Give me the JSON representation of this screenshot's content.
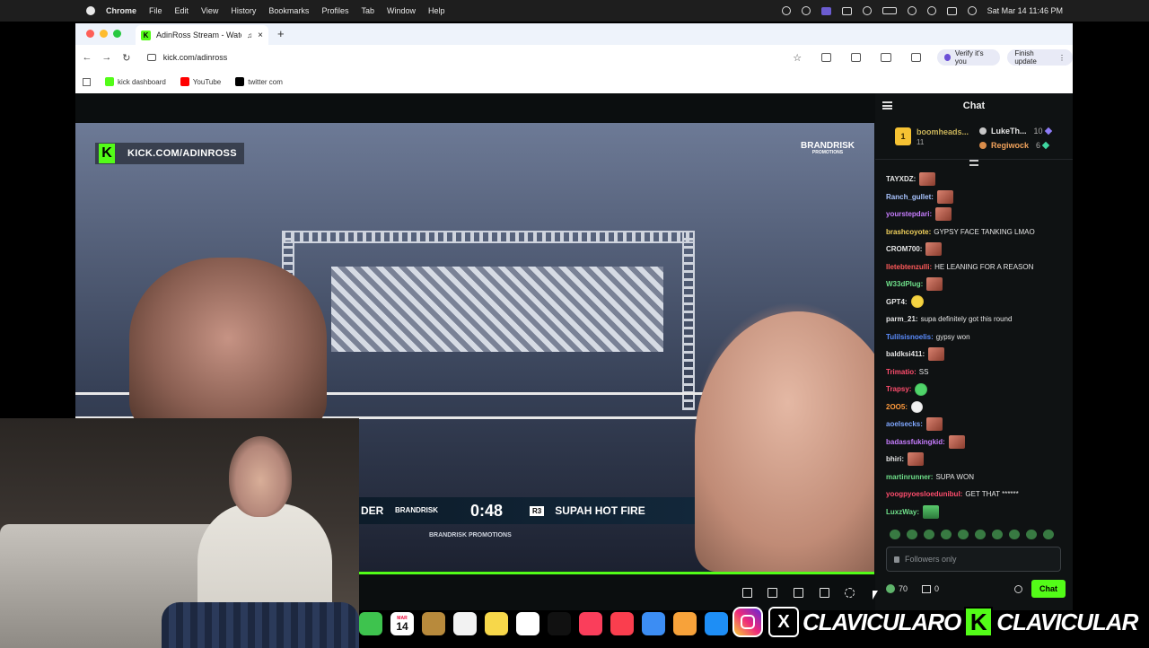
{
  "menubar": {
    "app": "Chrome",
    "items": [
      "File",
      "Edit",
      "View",
      "History",
      "Bookmarks",
      "Profiles",
      "Tab",
      "Window",
      "Help"
    ],
    "clock": "Sat Mar 14  11:46 PM"
  },
  "browser": {
    "tab_title": "AdinRoss Stream - Watch",
    "url": "kick.com/adinross",
    "verify_label": "Verify it's you",
    "finish_label": "Finish update",
    "bookmarks": [
      {
        "label": "kick dashboard",
        "color": "#53fc18"
      },
      {
        "label": "YouTube",
        "color": "#ff0000"
      },
      {
        "label": "twitter com",
        "color": "#000000"
      }
    ]
  },
  "video": {
    "watermark": "KICK.COM/ADINROSS",
    "corner_brand": "BRANDRISK",
    "corner_brand_sub": "PROMOTIONS",
    "score": {
      "left_name": "DER",
      "brand": "BRANDRISK",
      "time": "0:48",
      "round": "R3",
      "right_name": "SUPAH HOT FIRE",
      "promo": "BRANDRISK PROMOTIONS"
    },
    "progress_color": "#53fc18"
  },
  "chat": {
    "title": "Chat",
    "leaderboard": {
      "first": {
        "rank": "1",
        "name": "boomheads...",
        "gifts": "11"
      },
      "second": {
        "name": "LukeTh...",
        "count": "10"
      },
      "third": {
        "name": "Regiwock",
        "count": "6"
      }
    },
    "messages": [
      {
        "user": "TAYXDZ:",
        "color": "#e6e6e6",
        "text": "",
        "emote": "face"
      },
      {
        "user": "Ranch_gullet:",
        "color": "#a9c4ff",
        "text": "",
        "emote": "face"
      },
      {
        "user": "yourstepdari:",
        "color": "#c77dff",
        "text": "",
        "emote": "face"
      },
      {
        "user": "brashcoyote:",
        "color": "#f2d25c",
        "text": "GYPSY FACE TANKING LMAO",
        "emote": ""
      },
      {
        "user": "CROM700:",
        "color": "#e6e6e6",
        "text": "",
        "emote": "face"
      },
      {
        "user": "lletebtenzulli:",
        "color": "#ff5a5a",
        "text": "HE LEANING FOR A REASON",
        "emote": ""
      },
      {
        "user": "W33dPlug:",
        "color": "#6fe08a",
        "text": "",
        "emote": "face"
      },
      {
        "user": "GPT4:",
        "color": "#e6e6e6",
        "text": "",
        "emote": "yellow"
      },
      {
        "user": "parm_21:",
        "color": "#e6e6e6",
        "text": "supa definitely got this round",
        "emote": ""
      },
      {
        "user": "Tulilsisnoelis:",
        "color": "#5b8dff",
        "text": "gypsy won",
        "emote": ""
      },
      {
        "user": "baldksi411:",
        "color": "#e6e6e6",
        "text": "",
        "emote": "face"
      },
      {
        "user": "Trimatio:",
        "color": "#ff4d6d",
        "text": "SS",
        "emote": ""
      },
      {
        "user": "Trapsy:",
        "color": "#ff4d6d",
        "text": "",
        "emote": "green"
      },
      {
        "user": "2OO5:",
        "color": "#ff9a3c",
        "text": "",
        "emote": "skull"
      },
      {
        "user": "aoelsecks:",
        "color": "#7fa7ff",
        "text": "",
        "emote": "face"
      },
      {
        "user": "badassfukingkid:",
        "color": "#c77dff",
        "text": "",
        "emote": "face"
      },
      {
        "user": "bhiri:",
        "color": "#e6e6e6",
        "text": "",
        "emote": "face"
      },
      {
        "user": "martinrunner:",
        "color": "#6fe08a",
        "text": "SUPA WON",
        "emote": ""
      },
      {
        "user": "yoogpyoesloedunibul:",
        "color": "#ff4d6d",
        "text": "GET THAT ******",
        "emote": ""
      },
      {
        "user": "LuxzWay:",
        "color": "#6fe08a",
        "text": "",
        "emote": "frog"
      }
    ],
    "input_placeholder": "Followers only",
    "points": "70",
    "store_count": "0",
    "send_label": "Chat"
  },
  "dock": {
    "calendar_month": "MAR",
    "calendar_day": "14"
  },
  "overlay": {
    "name_left": "CLAVICULARO",
    "name_right": "CLAVICULAR"
  }
}
